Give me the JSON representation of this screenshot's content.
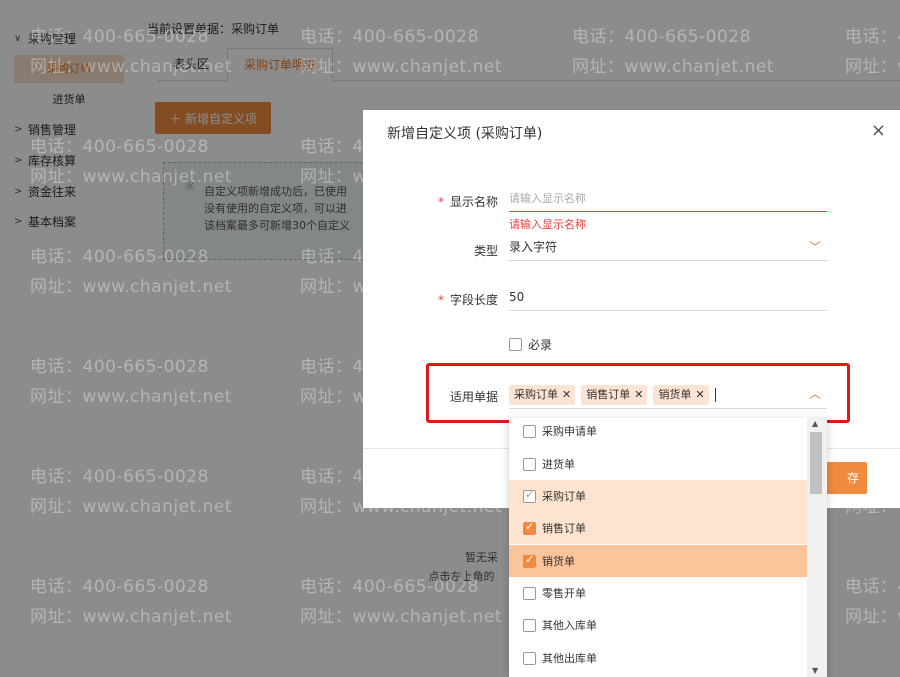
{
  "sidebar": {
    "groups": [
      {
        "label": "采购管理",
        "expanded": true
      },
      {
        "label": "销售管理",
        "expanded": false
      },
      {
        "label": "库存核算",
        "expanded": false
      },
      {
        "label": "资金往来",
        "expanded": false
      },
      {
        "label": "基本档案",
        "expanded": false
      }
    ],
    "sub_items": [
      {
        "label": "采购订单",
        "active": true
      },
      {
        "label": "进货单",
        "active": false
      }
    ]
  },
  "main": {
    "current_doc": "当前设置单据：采购订单",
    "tabs": [
      {
        "label": "表头区",
        "active": false
      },
      {
        "label": "采购订单明细",
        "active": true
      }
    ],
    "add_button": "新增自定义项",
    "tip_lines": [
      "自定义项新增成功后，已使用",
      "没有使用的自定义项，可以进",
      "该档案最多可新增30个自定义"
    ],
    "empty_lines": [
      "暂无采",
      "点击左上角的"
    ]
  },
  "watermark": {
    "phone": "电话：400-665-0028",
    "site": "网址：www.chanjet.net"
  },
  "dialog": {
    "title": "新增自定义项 (采购订单)",
    "close": "×",
    "fields": {
      "display_name": {
        "label": "显示名称",
        "placeholder": "请输入显示名称",
        "error": "请输入显示名称"
      },
      "type": {
        "label": "类型",
        "value": "录入字符"
      },
      "length": {
        "label": "字段长度",
        "value": "50"
      },
      "required": {
        "label": "必录"
      },
      "applicable": {
        "label": "适用单据",
        "chips": [
          "采购订单",
          "销售订单",
          "销货单"
        ]
      }
    },
    "save_label": "存"
  },
  "dropdown": {
    "options": [
      {
        "label": "采购申请单",
        "checked": false,
        "state": "none"
      },
      {
        "label": "进货单",
        "checked": false,
        "state": "none"
      },
      {
        "label": "采购订单",
        "checked": true,
        "state": "disabled"
      },
      {
        "label": "销售订单",
        "checked": true,
        "state": "checked"
      },
      {
        "label": "销货单",
        "checked": true,
        "state": "hover"
      },
      {
        "label": "零售开单",
        "checked": false,
        "state": "none"
      },
      {
        "label": "其他入库单",
        "checked": false,
        "state": "none"
      },
      {
        "label": "其他出库单",
        "checked": false,
        "state": "none"
      }
    ]
  },
  "colors": {
    "accent": "#f08a3e",
    "error": "#e84040",
    "highlight": "#e01818"
  }
}
